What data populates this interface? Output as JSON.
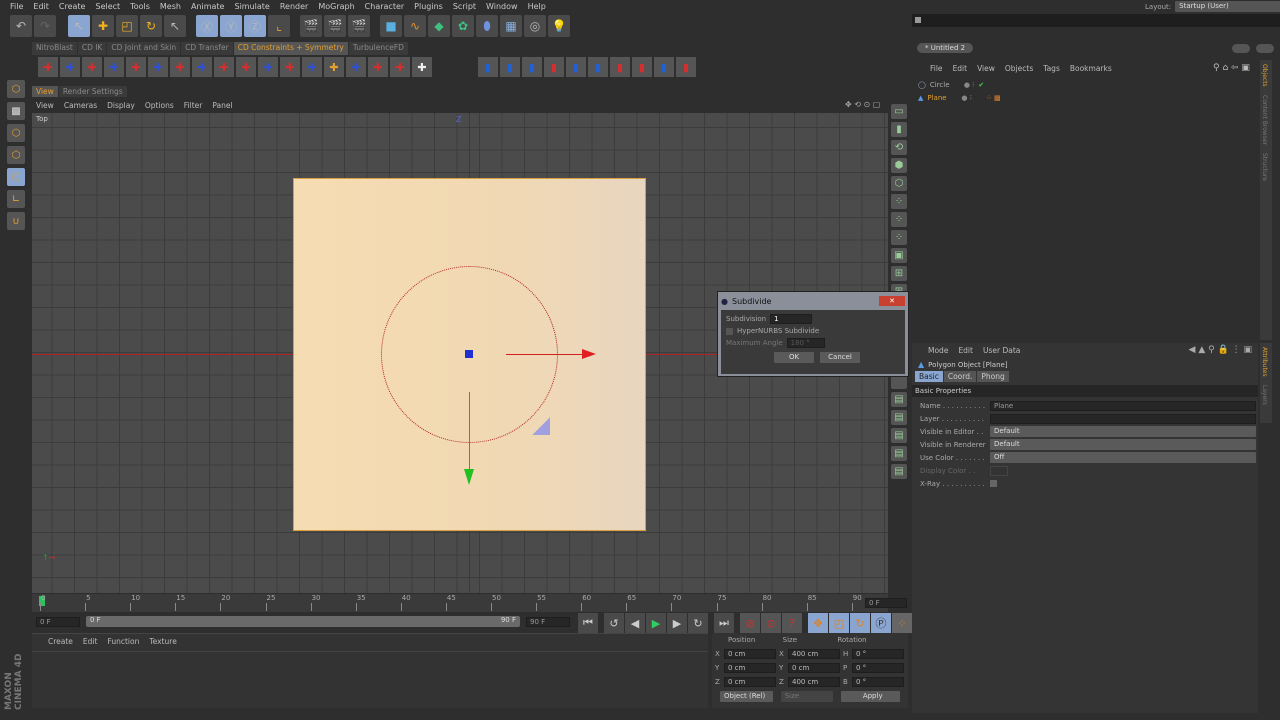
{
  "menu": [
    "File",
    "Edit",
    "Create",
    "Select",
    "Tools",
    "Mesh",
    "Animate",
    "Simulate",
    "Render",
    "MoGraph",
    "Character",
    "Plugins",
    "Script",
    "Window",
    "Help"
  ],
  "layout": {
    "label": "Layout:",
    "value": "Startup (User)"
  },
  "plugin_tabs": [
    "NitroBlast",
    "CD IK",
    "CD Joint and Skin",
    "CD Transfer",
    "CD Constraints + Symmetry",
    "TurbulenceFD"
  ],
  "viewport": {
    "tabs": [
      "View",
      "Render Settings"
    ],
    "menu": [
      "View",
      "Cameras",
      "Display",
      "Options",
      "Filter",
      "Panel"
    ],
    "name": "Top",
    "axis_z": "Z"
  },
  "object_manager": {
    "doc_tab": "* Untitled 2",
    "menu": [
      "File",
      "Edit",
      "View",
      "Objects",
      "Tags",
      "Bookmarks"
    ],
    "objects": [
      "Circle",
      "Plane"
    ],
    "side_tabs": [
      "Objects",
      "Content Browser",
      "Structure"
    ]
  },
  "attributes": {
    "menu": [
      "Mode",
      "Edit",
      "User Data"
    ],
    "title": "Polygon Object [Plane]",
    "tabs": [
      "Basic",
      "Coord.",
      "Phong"
    ],
    "section": "Basic Properties",
    "fields": [
      {
        "label": "Name . . . . . . . . . .",
        "value": "Plane"
      },
      {
        "label": "Layer . . . . . . . . . .",
        "value": ""
      },
      {
        "label": "Visible in Editor . .",
        "value": "Default"
      },
      {
        "label": "Visible in Renderer",
        "value": "Default"
      },
      {
        "label": "Use Color . . . . . . .",
        "value": "Off"
      },
      {
        "label": "Display Color . .",
        "value": ""
      },
      {
        "label": "X-Ray . . . . . . . . . .",
        "value": ""
      }
    ],
    "side_tabs": [
      "Attributes",
      "Layers"
    ]
  },
  "dialog": {
    "title": "Subdivide",
    "subdivision_label": "Subdivision",
    "subdivision_value": "1",
    "hypernurbs_label": "HyperNURBS Subdivide",
    "max_angle_label": "Maximum Angle",
    "max_angle_value": "180 °",
    "ok": "OK",
    "cancel": "Cancel"
  },
  "timeline": {
    "ticks": [
      "0",
      "5",
      "10",
      "15",
      "20",
      "25",
      "30",
      "35",
      "40",
      "45",
      "50",
      "55",
      "60",
      "65",
      "70",
      "75",
      "80",
      "85",
      "90"
    ],
    "current_frame": "0 F",
    "start": "0 F",
    "range_start": "0 F",
    "range_end": "90 F",
    "end": "90 F"
  },
  "material_manager": {
    "menu": [
      "Create",
      "Edit",
      "Function",
      "Texture"
    ]
  },
  "coordinates": {
    "headers": [
      "Position",
      "Size",
      "Rotation"
    ],
    "rows": [
      {
        "pl": "X",
        "p": "0 cm",
        "sl": "X",
        "s": "400 cm",
        "rl": "H",
        "r": "0 °"
      },
      {
        "pl": "Y",
        "p": "0 cm",
        "sl": "Y",
        "s": "0 cm",
        "rl": "P",
        "r": "0 °"
      },
      {
        "pl": "Z",
        "p": "0 cm",
        "sl": "Z",
        "s": "400 cm",
        "rl": "B",
        "r": "0 °"
      }
    ],
    "mode": "Object (Rel)",
    "size_mode": "Size",
    "apply": "Apply"
  },
  "branding": "MAXON CINEMA 4D"
}
